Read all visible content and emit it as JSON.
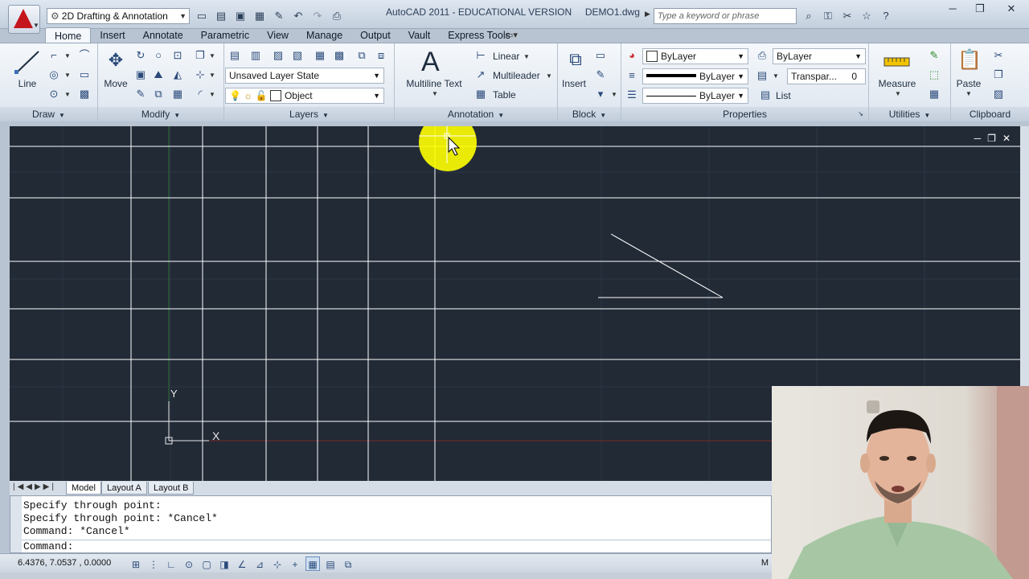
{
  "window": {
    "title": "AutoCAD 2011 - EDUCATIONAL VERSION     DEMO1.dwg",
    "workspace": "2D Drafting & Annotation",
    "search_placeholder": "Type a keyword or phrase"
  },
  "ribbon_tabs": [
    "Home",
    "Insert",
    "Annotate",
    "Parametric",
    "View",
    "Manage",
    "Output",
    "Vault",
    "Express Tools"
  ],
  "active_tab": "Home",
  "panels": {
    "draw": {
      "title": "Draw",
      "line_label": "Line"
    },
    "modify": {
      "title": "Modify",
      "move_label": "Move"
    },
    "layers": {
      "title": "Layers",
      "layer_state": "Unsaved Layer State",
      "current_layer": "Object"
    },
    "annotation": {
      "title": "Annotation",
      "mtext_label": "Multiline Text",
      "linear_label": "Linear",
      "multileader_label": "Multileader",
      "table_label": "Table"
    },
    "block": {
      "title": "Block",
      "insert_label": "Insert"
    },
    "properties": {
      "title": "Properties",
      "color": "ByLayer",
      "lineweight": "ByLayer",
      "linetype": "ByLayer",
      "plotstyle": "ByLayer",
      "transparency_label": "Transpar...",
      "transparency_value": "0",
      "list_label": "List"
    },
    "utilities": {
      "title": "Utilities",
      "measure_label": "Measure"
    },
    "clipboard": {
      "title": "Clipboard",
      "paste_label": "Paste"
    }
  },
  "layout_tabs": [
    "Model",
    "Layout A",
    "Layout B"
  ],
  "active_layout": "Model",
  "command_history": [
    "Specify through point:",
    "Specify through point: *Cancel*",
    "Command: *Cancel*"
  ],
  "command_prompt": "Command:",
  "status": {
    "coordinates": "6.4376, 7.0537 , 0.0000",
    "right_text": "M"
  },
  "ucs": {
    "x_label": "X",
    "y_label": "Y"
  },
  "colors": {
    "canvas_bg": "#222a36",
    "construction_line": "#ffffff",
    "highlight": "#ffff00",
    "accent": "#c4161c"
  }
}
